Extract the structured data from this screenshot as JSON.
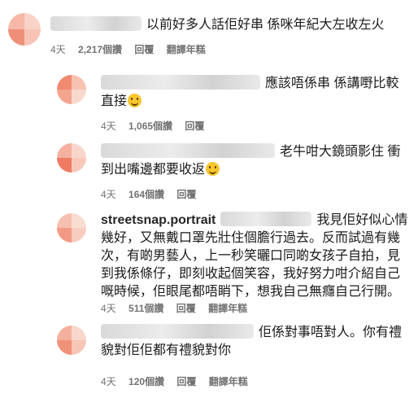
{
  "comments": [
    {
      "username": "",
      "text": "以前好多人話佢好串 係咪年紀大左收左火",
      "emoji": false,
      "time": "4天",
      "likes": "2,217個讚",
      "reply": "回覆",
      "translate": "翻譯年糕"
    },
    {
      "username": "",
      "text": "應該唔係串 係講嘢比較直接",
      "emoji": true,
      "time": "4天",
      "likes": "1,065個讚",
      "reply": "回覆",
      "translate": ""
    },
    {
      "username": "",
      "text": "老牛咁大鏡頭影住 衝到出嘴邊都要收返",
      "emoji": true,
      "time": "4天",
      "likes": "164個讚",
      "reply": "回覆",
      "translate": ""
    },
    {
      "username": "streetsnap.portrait",
      "text": "我見佢好似心情幾好，又無戴口罩先壯住個膽行過去。反而試過有幾次，有啲男藝人，上一秒笑曬口同啲女孩子自拍，見到我係條仔，即刻收起個笑容，我好努力咁介紹自己嘅時候，佢眼尾都唔睄下，想我自己無癮自己行開。",
      "emoji": false,
      "time": "4天",
      "likes": "511個讚",
      "reply": "回覆",
      "translate": "翻譯年糕"
    },
    {
      "username": "",
      "text": "佢係對事唔對人。你有禮貌對佢佢都有禮貌對你",
      "emoji": false,
      "time": "4天",
      "likes": "120個讚",
      "reply": "回覆",
      "translate": "翻譯年糕"
    }
  ]
}
